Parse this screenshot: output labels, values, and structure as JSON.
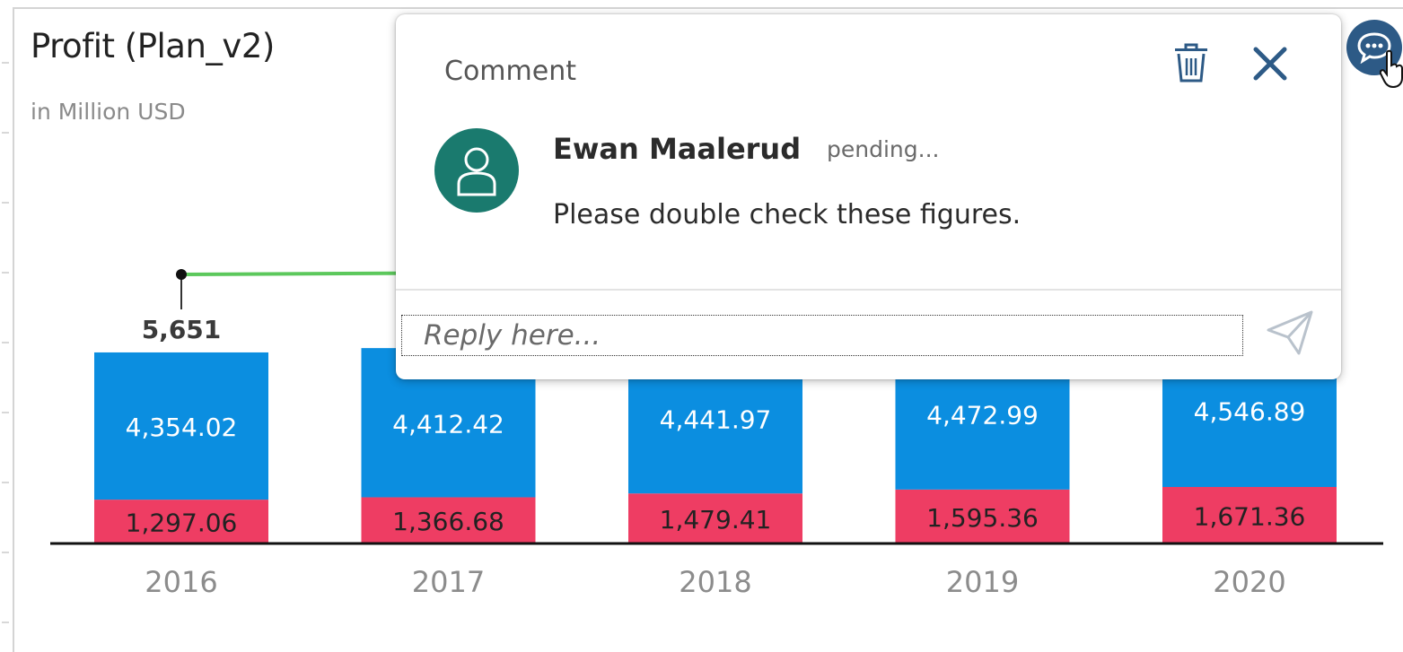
{
  "widget": {
    "title": "Profit (Plan_v2)",
    "subtitle": "in Million USD"
  },
  "chart_data": {
    "type": "bar",
    "stacked": true,
    "categories": [
      "2016",
      "2017",
      "2018",
      "2019",
      "2020"
    ],
    "series": [
      {
        "values": [
          1297.06,
          1366.68,
          1479.41,
          1595.36,
          1671.36
        ],
        "color": "#ee3d63"
      },
      {
        "values": [
          4354.02,
          4412.42,
          4441.97,
          4472.99,
          4546.89
        ],
        "color": "#0b8ee0"
      }
    ],
    "segment_labels": [
      [
        "1,297.06",
        "1,366.68",
        "1,479.41",
        "1,595.36",
        "1,671.36"
      ],
      [
        "4,354.02",
        "4,412.42",
        "4,441.97",
        "4,472.99",
        "4,546.89"
      ]
    ],
    "total_labels": [
      "5,651"
    ],
    "line_series": {
      "color": "#5cc85c"
    },
    "grid": false
  },
  "comment_popover": {
    "title": "Comment",
    "author": "Ewan Maalerud",
    "status": "pending...",
    "text": "Please double check these figures.",
    "reply_placeholder": "Reply here..."
  },
  "icons": {
    "comment_button": "comment-bubble-icon",
    "delete": "trash-icon",
    "close": "close-icon",
    "avatar": "person-icon",
    "send": "send-icon",
    "cursor": "hand-cursor-icon"
  },
  "colors": {
    "accent": "#2d5a86",
    "avatar": "#1a7a6e",
    "close": "#2d5a86"
  }
}
